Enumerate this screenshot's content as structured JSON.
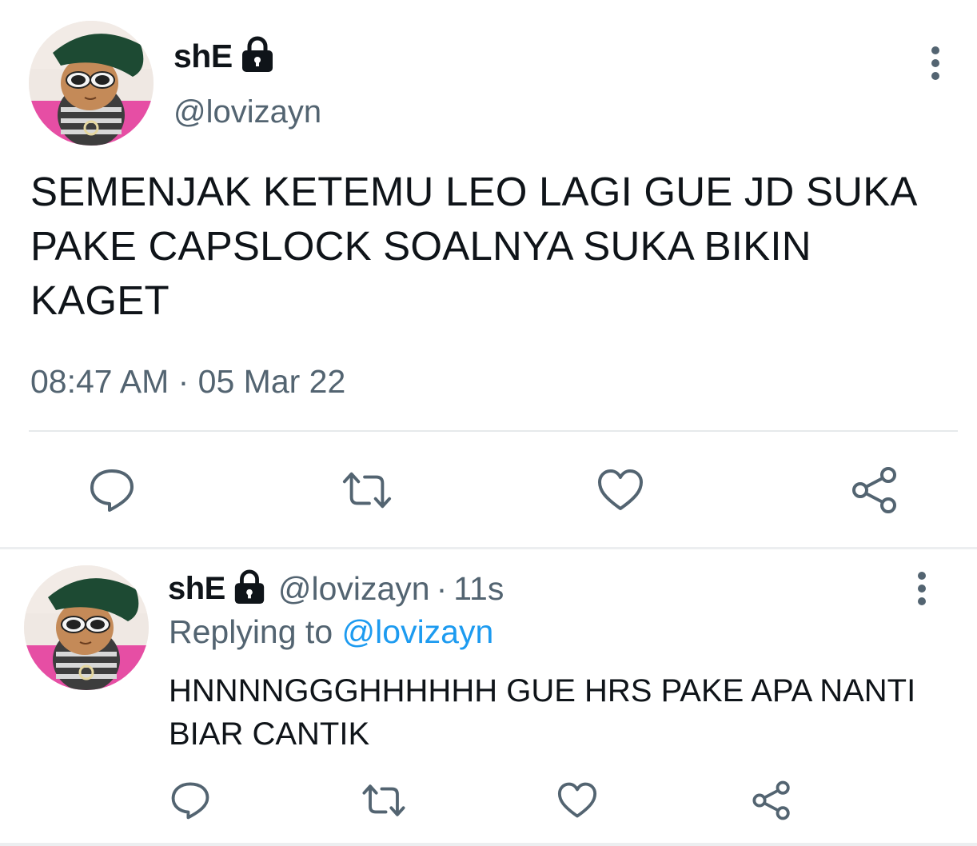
{
  "main_tweet": {
    "display_name": "shE",
    "handle": "@lovizayn",
    "text": "SEMENJAK KETEMU LEO LAGI GUE JD SUKA PAKE CAPSLOCK SOALNYA SUKA BIKIN KAGET",
    "timestamp": "08:47 AM · 05 Mar 22",
    "avatar_icon": "avatar-kitten-sunglasses",
    "lock_icon": "lock-icon",
    "actions": [
      "reply-icon",
      "retweet-icon",
      "like-icon",
      "share-icon"
    ]
  },
  "reply_tweet": {
    "display_name": "shE",
    "handle": "@lovizayn",
    "separator": "·",
    "time_ago": "11s",
    "replying_prefix": "Replying to",
    "replying_mention": "@lovizayn",
    "text": "HNNNNGGGHHHHHH GUE HRS PAKE APA NANTI BIAR CANTIK",
    "avatar_icon": "avatar-kitten-sunglasses",
    "actions": [
      "reply-icon",
      "retweet-icon",
      "like-icon",
      "share-icon"
    ]
  },
  "colors": {
    "text_primary": "#0f1419",
    "text_secondary": "#536471",
    "link": "#1d9bf0",
    "divider": "#e6e9eb"
  }
}
